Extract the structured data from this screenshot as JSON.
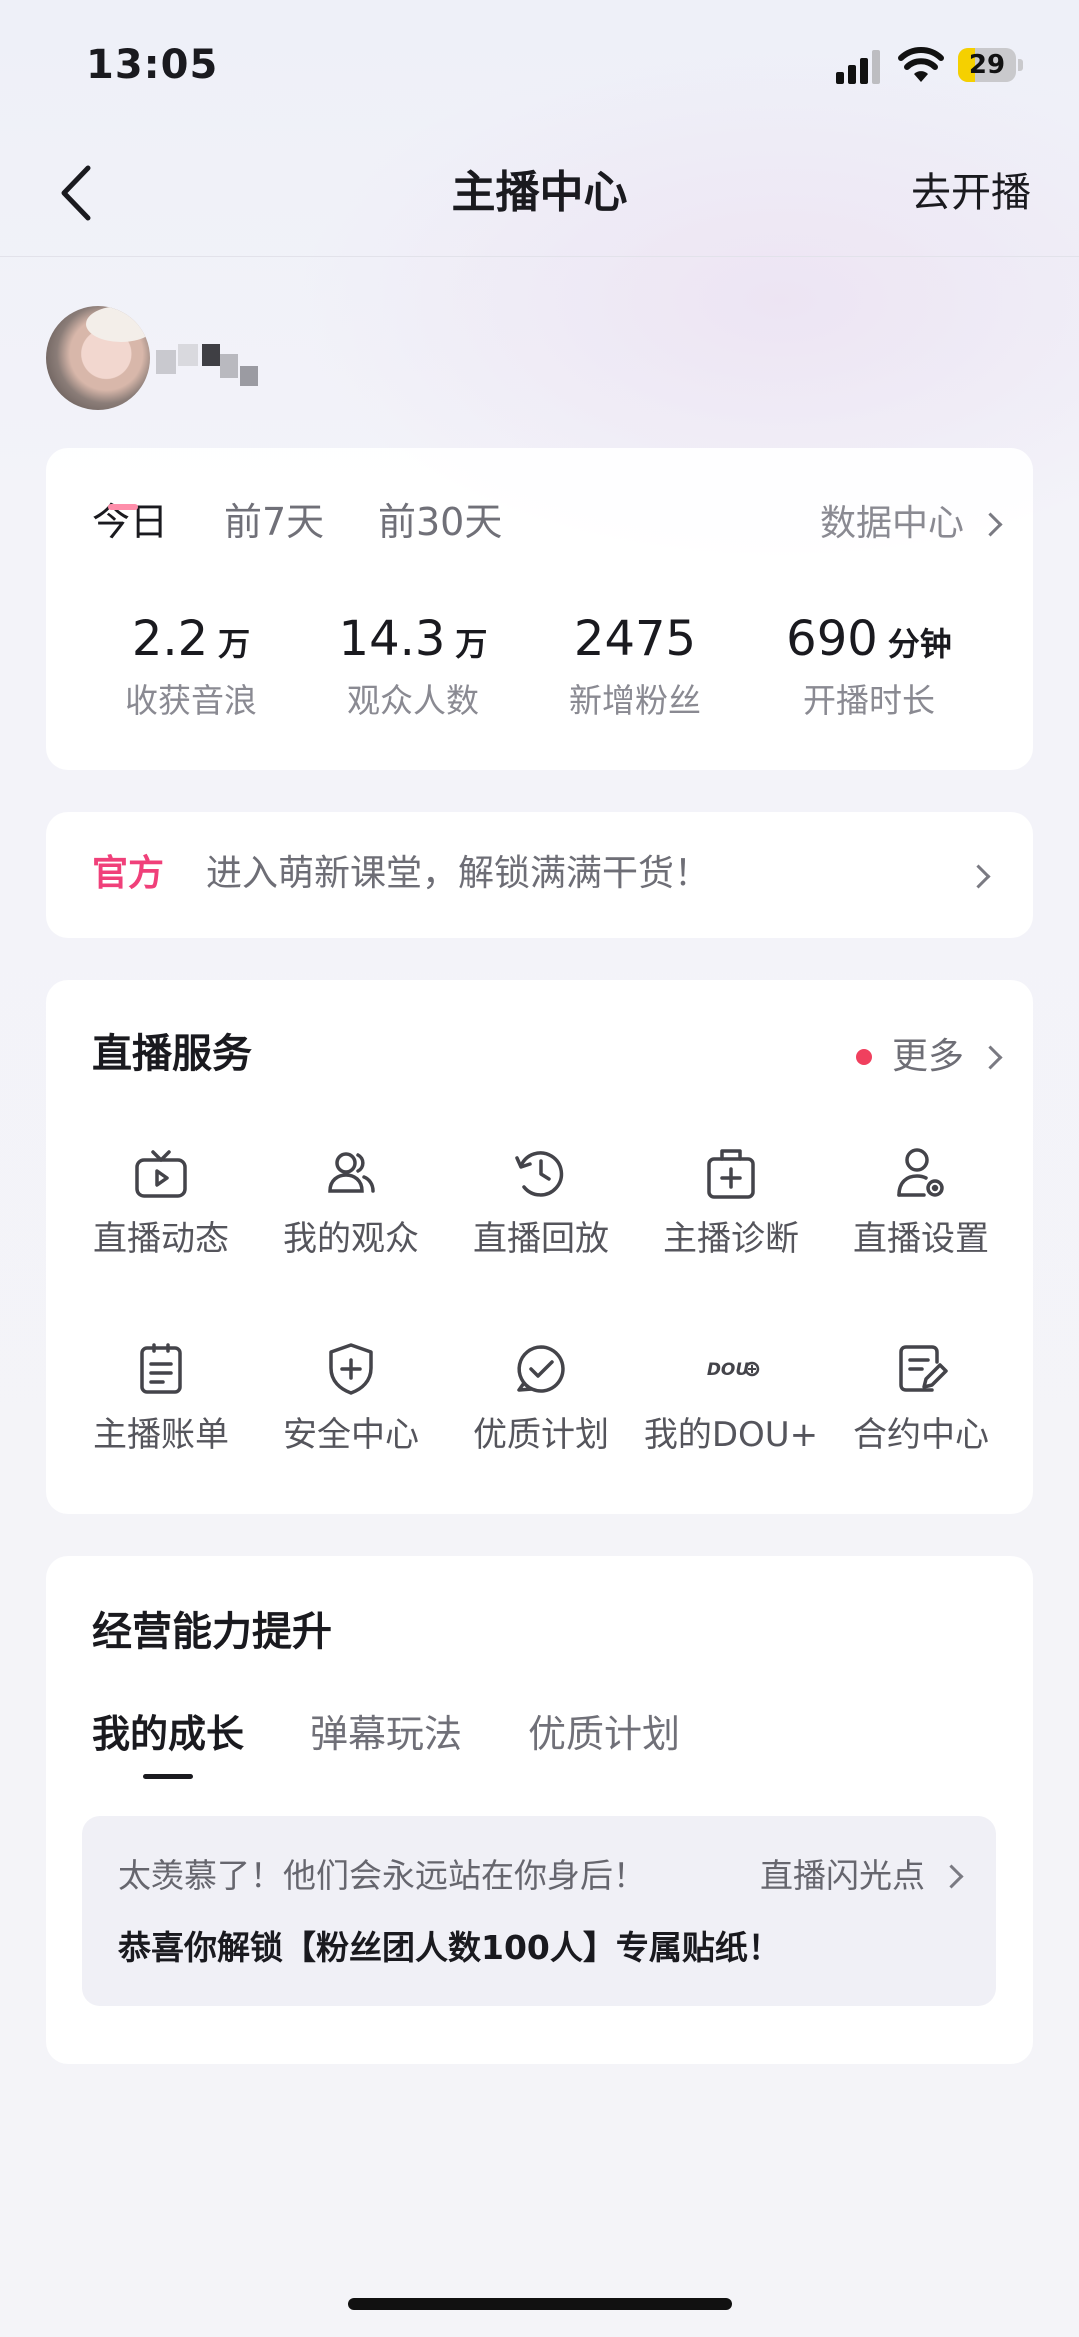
{
  "status_bar": {
    "time": "13:05",
    "battery_level": "29",
    "battery_fraction": 0.29
  },
  "nav": {
    "title": "主播中心",
    "right_action": "去开播"
  },
  "stats": {
    "periods": [
      "今日",
      "前7天",
      "前30天"
    ],
    "active_period": "今日",
    "data_center_label": "数据中心",
    "items": [
      {
        "value": "2.2",
        "unit": "万",
        "label": "收获音浪"
      },
      {
        "value": "14.3",
        "unit": "万",
        "label": "观众人数"
      },
      {
        "value": "2475",
        "unit": "",
        "label": "新增粉丝"
      },
      {
        "value": "690",
        "unit": "分钟",
        "label": "开播时长"
      }
    ]
  },
  "notice": {
    "tag": "官方",
    "text": "进入萌新课堂，解锁满满干货！"
  },
  "services": {
    "title": "直播服务",
    "more_label": "更多",
    "items": [
      {
        "label": "直播动态",
        "icon": "tv-icon"
      },
      {
        "label": "我的观众",
        "icon": "users-icon"
      },
      {
        "label": "直播回放",
        "icon": "history-icon"
      },
      {
        "label": "主播诊断",
        "icon": "medical-kit-icon"
      },
      {
        "label": "直播设置",
        "icon": "user-settings-icon"
      },
      {
        "label": "主播账单",
        "icon": "bill-icon"
      },
      {
        "label": "安全中心",
        "icon": "shield-plus-icon"
      },
      {
        "label": "优质计划",
        "icon": "check-circle-icon"
      },
      {
        "label": "我的DOU+",
        "icon": "dou-plus-icon",
        "icon_text": "DOU"
      },
      {
        "label": "合约中心",
        "icon": "contract-edit-icon"
      }
    ]
  },
  "growth": {
    "title": "经营能力提升",
    "tabs": [
      "我的成长",
      "弹幕玩法",
      "优质计划"
    ],
    "active_tab": "我的成长",
    "line1": "太羡慕了！他们会永远站在你身后！",
    "link": "直播闪光点",
    "line2": "恭喜你解锁【粉丝团人数100人】专属贴纸！"
  },
  "colors": {
    "accent_pink": "#f0407a",
    "red_dot": "#f0405e",
    "battery_yellow": "#f5d000"
  }
}
